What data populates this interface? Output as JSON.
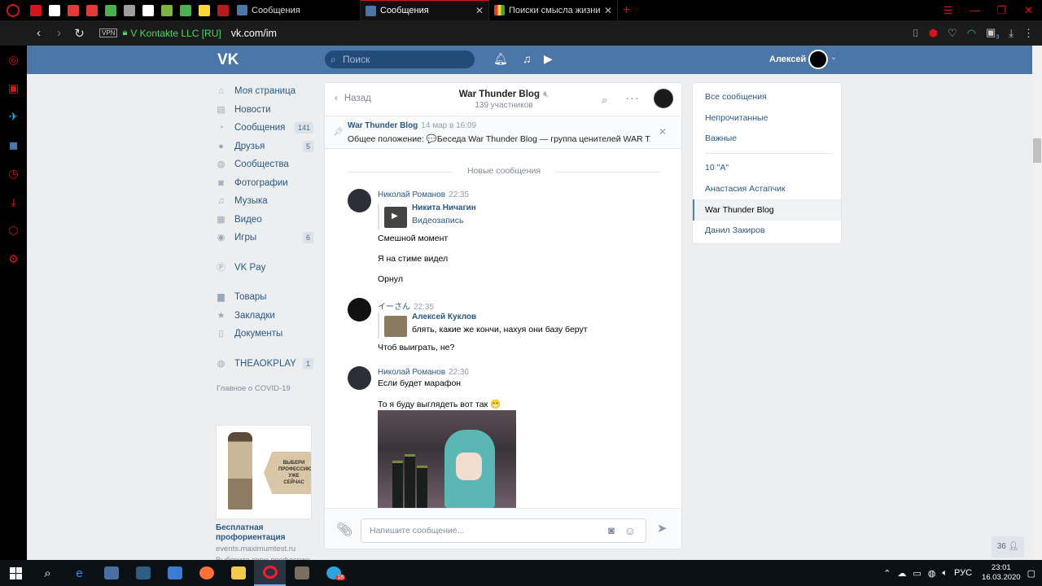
{
  "browser": {
    "tabs": [
      {
        "title": "Сообщения",
        "active": false
      },
      {
        "title": "Сообщения",
        "active": true
      },
      {
        "title": "Поиски смысла жизни гл",
        "active": false
      }
    ],
    "pinned_colors": [
      "#d4151c",
      "#ffffff",
      "#e53935",
      "#e53935",
      "#4caf50",
      "#9e9e9e",
      "#ffffff",
      "#7cb342",
      "#4caf50",
      "#fdd835",
      "#b71c1c"
    ],
    "vpn_label": "VPN",
    "site_name": "V Kontakte LLC [RU]",
    "url": "vk.com/im",
    "ext_badge": "3"
  },
  "vk": {
    "search_placeholder": "Поиск",
    "user_name": "Алексей",
    "nav": [
      {
        "label": "Моя страница",
        "icon": "home-icon"
      },
      {
        "label": "Новости",
        "icon": "news-icon"
      },
      {
        "label": "Сообщения",
        "icon": "messages-icon",
        "count": "141"
      },
      {
        "label": "Друзья",
        "icon": "friends-icon",
        "count": "5"
      },
      {
        "label": "Сообщества",
        "icon": "communities-icon"
      },
      {
        "label": "Фотографии",
        "icon": "camera-icon"
      },
      {
        "label": "Музыка",
        "icon": "music-icon"
      },
      {
        "label": "Видео",
        "icon": "video-icon"
      },
      {
        "label": "Игры",
        "icon": "games-icon",
        "count": "6"
      }
    ],
    "nav2": [
      {
        "label": "VK Pay",
        "icon": "vkpay-icon"
      }
    ],
    "nav3": [
      {
        "label": "Товары",
        "icon": "bag-icon"
      },
      {
        "label": "Закладки",
        "icon": "star-icon"
      },
      {
        "label": "Документы",
        "icon": "document-icon"
      }
    ],
    "nav4": [
      {
        "label": "THEAOKPLAY",
        "icon": "group-icon",
        "count": "1"
      }
    ],
    "covid_link": "Главное о COVID-19",
    "ad": {
      "banner_text": "ВЫБЕРИ ПРОФЕССИЮ УЖЕ СЕЙЧАС",
      "title": "Бесплатная профориентация",
      "url": "events.maximumtest.ru",
      "more": "Выберите свою профессию"
    },
    "chat": {
      "back_label": "Назад",
      "title": "War Thunder Blog",
      "members": "139 участников",
      "pinned": {
        "author": "War Thunder Blog",
        "date": "14 мар в 16:09",
        "text": "Общее положение: 💬Беседа War Thunder Blog — группа ценителей WAR T..."
      },
      "new_messages_label": "Новые сообщения",
      "messages": [
        {
          "author": "Николай Романов",
          "time": "22:35",
          "forward": {
            "name": "Никита Ничагин",
            "sub": "Видеозапись"
          },
          "lines": [
            "Смешной момент",
            "Я на стиме видел",
            "Орнул"
          ]
        },
        {
          "author": "イーさん",
          "time": "22:35",
          "forward": {
            "name": "Алексей Куклов",
            "sub": "блять, какие же кончи, нахуя они базу берут"
          },
          "lines": [
            "Чтоб выиграть, не?"
          ]
        },
        {
          "author": "Николай Романов",
          "time": "22:36",
          "lines": [
            "Если будет марафон",
            "То я буду выглядеть вот так 😁"
          ]
        }
      ],
      "input_placeholder": "Напишите сообщение..."
    },
    "right_menu": {
      "filters": [
        "Все сообщения",
        "Непрочитанные",
        "Важные"
      ],
      "chats": [
        "10 \"А\"",
        "Анастасия Астапчик",
        "War Thunder Blog",
        "Данил Закиров"
      ],
      "active_chat": "War Thunder Blog"
    },
    "online_count": "36"
  },
  "taskbar": {
    "lang": "РУС",
    "time": "23:01",
    "date": "16.03.2020",
    "badge": "18"
  },
  "colors": {
    "accent": "#4a76a8",
    "opera": "#d4151c",
    "link": "#2a5885"
  }
}
